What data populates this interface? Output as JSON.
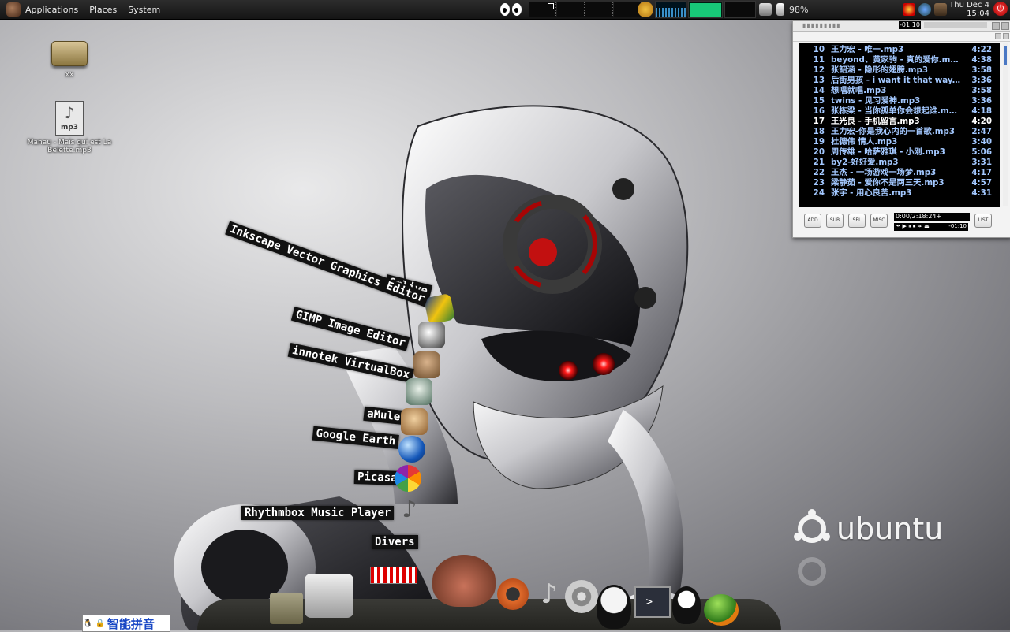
{
  "top_panel": {
    "menus": [
      "Applications",
      "Places",
      "System"
    ],
    "battery": "98%",
    "clock_date": "Thu Dec  4",
    "clock_time": "15:04"
  },
  "desktop_icons": [
    {
      "label": "xx"
    },
    {
      "label": "Manau - Mais qui est La Belette.mp3",
      "badge": "mp3"
    }
  ],
  "stack_launcher": [
    {
      "label": "Gmlive",
      "icon": "gmlive-icon"
    },
    {
      "label": "Inkscape Vector Graphics Editor",
      "icon": "inkscape-icon"
    },
    {
      "label": "GIMP Image Editor",
      "icon": "gimp-icon"
    },
    {
      "label": "innotek VirtualBox",
      "icon": "virtualbox-icon"
    },
    {
      "label": "aMule",
      "icon": "amule-icon"
    },
    {
      "label": "Google Earth",
      "icon": "google-earth-icon"
    },
    {
      "label": "Picasa",
      "icon": "picasa-icon"
    },
    {
      "label": "Rhythmbox Music Player",
      "icon": "rhythmbox-icon"
    },
    {
      "label": "Divers",
      "icon": "divers-stack-icon"
    }
  ],
  "player": {
    "title_time": "-01:10",
    "playlist": [
      {
        "num": "10",
        "title": "王力宏 - 唯一.mp3",
        "duration": "4:22"
      },
      {
        "num": "11",
        "title": "beyond、黄家驹 - 真的爱你.mp3",
        "duration": "4:38"
      },
      {
        "num": "12",
        "title": "张韶涵 - 隐形的翅膀.mp3",
        "duration": "3:58"
      },
      {
        "num": "13",
        "title": "后街男孩 - i want it that way.mp3",
        "duration": "3:36"
      },
      {
        "num": "14",
        "title": "想唱就唱.mp3",
        "duration": "3:58"
      },
      {
        "num": "15",
        "title": "twins - 见习爱神.mp3",
        "duration": "3:36"
      },
      {
        "num": "16",
        "title": "张栋梁 - 当你孤单你会想起谁.mp3",
        "duration": "4:18"
      },
      {
        "num": "17",
        "title": "王光良 - 手机留言.mp3",
        "duration": "4:20"
      },
      {
        "num": "18",
        "title": "王力宏-你是我心内的一首歌.mp3",
        "duration": "2:47"
      },
      {
        "num": "19",
        "title": "杜德伟 情人.mp3",
        "duration": "3:40"
      },
      {
        "num": "20",
        "title": "周传雄 - 哈萨雅琪 - 小刚.mp3",
        "duration": "5:06"
      },
      {
        "num": "21",
        "title": "by2-好好爱.mp3",
        "duration": "3:31"
      },
      {
        "num": "22",
        "title": "王杰 - 一场游戏一场梦.mp3",
        "duration": "4:17"
      },
      {
        "num": "23",
        "title": "梁静茹 - 爱你不是两三天.mp3",
        "duration": "4:57"
      },
      {
        "num": "24",
        "title": "张宇 - 用心良苦.mp3",
        "duration": "4:31"
      }
    ],
    "current_index": 7,
    "buttons": [
      "ADD",
      "SUB",
      "SEL",
      "MISC",
      "LIST"
    ],
    "time_display": "0:00/2:18:24+",
    "remaining": "-01:10"
  },
  "wallpaper_brand": "ubuntu",
  "ime_label": "智能拼音",
  "dock": [
    {
      "name": "file-manager-icon"
    },
    {
      "name": "system-tools-icon"
    },
    {
      "name": "stack-icon"
    },
    {
      "name": "firefox-fox-icon"
    },
    {
      "name": "disc-burner-icon"
    },
    {
      "name": "music-note-icon"
    },
    {
      "name": "film-reel-icon"
    },
    {
      "name": "tux-emoticon-icon"
    },
    {
      "name": "terminal-icon"
    },
    {
      "name": "qq-penguin-icon"
    },
    {
      "name": "network-ball-icon"
    }
  ],
  "colors": {
    "panel_bg": "#1e1e1e",
    "playlist_bg": "#000000",
    "playlist_text": "#a3c8ff",
    "playlist_current": "#ffffff",
    "robot_eye": "#ff1a1a"
  }
}
